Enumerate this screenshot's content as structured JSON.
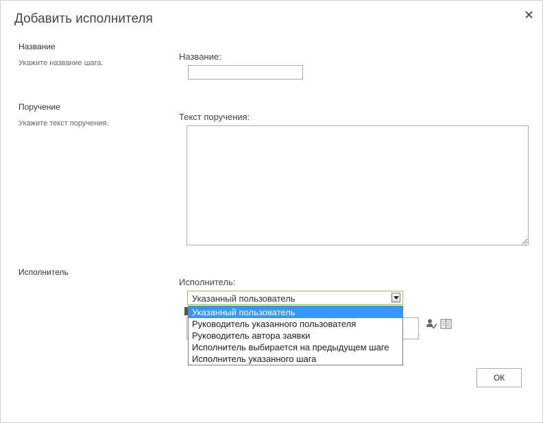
{
  "dialog": {
    "title": "Добавить исполнителя",
    "close_icon": "close-icon"
  },
  "sections": {
    "name": {
      "title": "Название",
      "description": "Укажите название шага.",
      "field_label": "Название:",
      "value": ""
    },
    "instruction": {
      "title": "Поручение",
      "description": "Укажите текст поручения.",
      "field_label": "Текст поручения:",
      "value": ""
    },
    "assignee": {
      "title": "Исполнитель",
      "field_label": "Исполнитель:",
      "selected": "Указанный пользователь",
      "options": [
        "Указанный пользователь",
        "Руководитель указанного пользователя",
        "Руководитель автора заявки",
        "Исполнитель выбирается на предыдущем шаге",
        "Исполнитель указанного шага"
      ],
      "check_names_icon": "check-names-icon",
      "address_book_icon": "address-book-icon"
    }
  },
  "footer": {
    "ok_label": "ОК"
  },
  "colors": {
    "selected_option_bg": "#3399ff",
    "select_border": "#9fb86a"
  }
}
